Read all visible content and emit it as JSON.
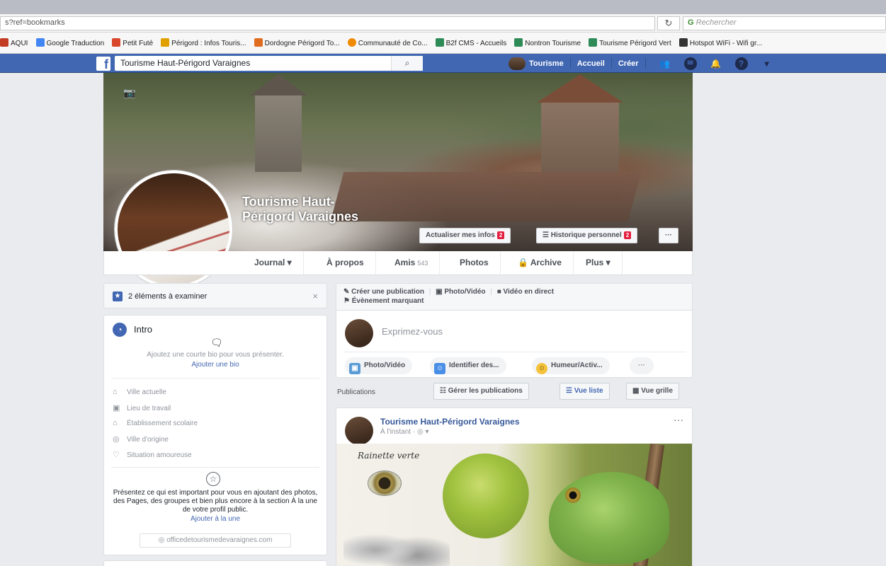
{
  "browser": {
    "url": "s?ref=bookmarks",
    "reload_icon": "reload-icon",
    "search_placeholder": "Rechercher",
    "bookmarks": [
      {
        "label": "AQUI",
        "color": "#c23b22"
      },
      {
        "label": "Google Traduction",
        "color": "#4285f4"
      },
      {
        "label": "Petit Futé",
        "color": "#d9462b"
      },
      {
        "label": "Périgord : Infos Touris...",
        "color": "#e0a100"
      },
      {
        "label": "Dordogne Périgord To...",
        "color": "#e06d1f"
      },
      {
        "label": "Communauté de Co...",
        "color": "#f08a00"
      },
      {
        "label": "B2f CMS - Accueils",
        "color": "#2e8b57"
      },
      {
        "label": "Nontron Tourisme",
        "color": "#2e8b57"
      },
      {
        "label": "Tourisme Périgord Vert",
        "color": "#2e8b57"
      },
      {
        "label": "Hotspot WiFi - Wifi gr...",
        "color": "#333333"
      }
    ]
  },
  "fb_header": {
    "logo": "f",
    "search_value": "Tourisme Haut-Périgord Varaignes",
    "profile_label": "Tourisme",
    "home_label": "Accueil",
    "create_label": "Créer",
    "icons": [
      "friends-icon",
      "messenger-icon",
      "notifications-icon",
      "help-icon",
      "dropdown-icon"
    ]
  },
  "cover": {
    "page_name": "Tourisme Haut-Périgord Varaignes",
    "update_info_label": "Actualiser mes infos",
    "update_info_badge": "2",
    "history_label": "Historique personnel",
    "history_badge": "2",
    "more_label": "···"
  },
  "tabs": [
    {
      "label": "Journal ▾"
    },
    {
      "label": "À propos"
    },
    {
      "label": "Amis",
      "count": "543"
    },
    {
      "label": "Photos"
    },
    {
      "label": "Archive"
    },
    {
      "label": "Plus ▾"
    }
  ],
  "review": {
    "text": "2 éléments à examiner",
    "close": "×"
  },
  "intro": {
    "title": "Intro",
    "bio_prompt": "Ajoutez une courte bio pour vous présenter.",
    "add_bio": "Ajouter une bio",
    "rows": [
      "Ville actuelle",
      "Lieu de travail",
      "Établissement scolaire",
      "Ville d'origine",
      "Situation amoureuse"
    ],
    "present_text": "Présentez ce qui est important pour vous en ajoutant des photos, des Pages, des groupes et bien plus encore à la section À la une de votre profil public.",
    "featured_link": "Ajouter à la une",
    "website": "officedetourismedevaraignes.com"
  },
  "composer": {
    "create_post": "Créer une publication",
    "photo_video": "Photo/Vidéo",
    "live_video": "Vidéo en direct",
    "life_event": "Évènement marquant",
    "placeholder": "Exprimez-vous",
    "pill_photo": "Photo/Vidéo",
    "pill_tag": "Identifier des...",
    "pill_mood": "Humeur/Activ...",
    "pill_more": "···"
  },
  "publications": {
    "label": "Publications",
    "manage": "Gérer les publications",
    "list_view": "Vue liste",
    "grid_view": "Vue grille"
  },
  "post": {
    "author": "Tourisme Haut-Périgord Varaignes",
    "time": "À l'instant ·",
    "more": "···",
    "sketch_title": "Rainette verte"
  }
}
